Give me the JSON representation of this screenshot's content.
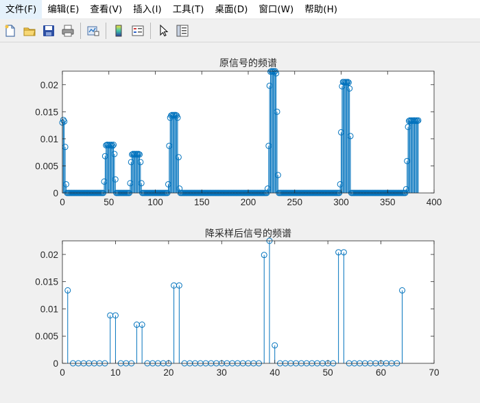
{
  "menu": {
    "items": [
      "文件(F)",
      "编辑(E)",
      "查看(V)",
      "插入(I)",
      "工具(T)",
      "桌面(D)",
      "窗口(W)",
      "帮助(H)"
    ]
  },
  "toolbar": {
    "buttons": [
      "new-figure-icon",
      "open-folder-icon",
      "save-icon",
      "print-icon",
      "link-plot-icon",
      "colorbar-icon",
      "legend-icon",
      "pointer-icon",
      "property-inspector-icon"
    ]
  },
  "colors": {
    "stem": "#0072BD",
    "axis": "#262626",
    "background": "#f0f0f0",
    "plot_bg": "#ffffff"
  },
  "chart_data": [
    {
      "type": "stem",
      "title": "原信号的频谱",
      "xlabel": "",
      "ylabel": "",
      "xlim": [
        0,
        400
      ],
      "ylim": [
        0,
        0.0225
      ],
      "xticks": [
        "0",
        "50",
        "100",
        "150",
        "200",
        "250",
        "300",
        "350",
        "400"
      ],
      "xtick_values": [
        0,
        50,
        100,
        150,
        200,
        250,
        300,
        350,
        400
      ],
      "yticks": [
        "0",
        "0.005",
        "0.01",
        "0.015",
        "0.02"
      ],
      "ytick_values": [
        0,
        0.005,
        0.01,
        0.015,
        0.02
      ],
      "grid": false,
      "n": 384,
      "segments": [
        {
          "x": [
            0,
            1,
            2,
            3,
            4,
            5
          ],
          "y": [
            0.013,
            0.0135,
            0.0132,
            0.0085,
            0.0016,
            0
          ]
        },
        {
          "x": [
            44,
            45,
            46,
            47,
            48,
            49,
            50,
            51,
            52,
            53,
            54,
            55,
            56,
            57,
            58
          ],
          "y": [
            0,
            0.0021,
            0.0068,
            0.0088,
            0.0089,
            0.0089,
            0.0088,
            0.0089,
            0.0088,
            0.0089,
            0.0087,
            0.0089,
            0.0072,
            0.0025,
            0
          ]
        },
        {
          "x": [
            72,
            73,
            74,
            75,
            76,
            77,
            78,
            79,
            80,
            81,
            82,
            83,
            84,
            85,
            86
          ],
          "y": [
            0,
            0.0018,
            0.0057,
            0.0071,
            0.0072,
            0.0071,
            0.0072,
            0.0071,
            0.0072,
            0.0071,
            0.0072,
            0.0071,
            0.0057,
            0.0018,
            0
          ]
        },
        {
          "x": [
            113,
            114,
            115,
            116,
            117,
            118,
            119,
            120,
            121,
            122,
            123,
            124,
            125,
            126,
            127,
            128
          ],
          "y": [
            0,
            0.0016,
            0.0087,
            0.0139,
            0.0143,
            0.0144,
            0.0143,
            0.0144,
            0.0143,
            0.0144,
            0.0143,
            0.0139,
            0.0066,
            0.0008,
            0,
            0
          ]
        },
        {
          "x": [
            220,
            221,
            222,
            223,
            224,
            225,
            226,
            227,
            228,
            229,
            230,
            231,
            232
          ],
          "y": [
            0,
            0.0008,
            0.0087,
            0.0198,
            0.0224,
            0.0225,
            0.0224,
            0.0225,
            0.0224,
            0.0225,
            0.0221,
            0.015,
            0.0033
          ]
        },
        {
          "x": [
            298,
            299,
            300,
            301,
            302,
            303,
            304,
            305,
            306,
            307,
            308,
            309,
            310,
            311
          ],
          "y": [
            0,
            0.0016,
            0.0112,
            0.0197,
            0.0205,
            0.0205,
            0.0204,
            0.0205,
            0.0204,
            0.0205,
            0.0204,
            0.0193,
            0.0105,
            0
          ]
        },
        {
          "x": [
            369,
            370,
            371,
            372,
            373,
            374,
            375,
            376,
            377,
            378,
            379,
            380,
            381,
            382,
            383
          ],
          "y": [
            0,
            0.0007,
            0.0059,
            0.0122,
            0.0133,
            0.0134,
            0.0133,
            0.0134,
            0.0133,
            0.0134,
            0.0134,
            0.0133,
            0.0134,
            0.0133,
            0.0134
          ]
        }
      ]
    },
    {
      "type": "stem",
      "title": "降采样后信号的频谱",
      "xlabel": "",
      "ylabel": "",
      "xlim": [
        0,
        70
      ],
      "ylim": [
        0,
        0.0225
      ],
      "xticks": [
        "0",
        "10",
        "20",
        "30",
        "40",
        "50",
        "60",
        "70"
      ],
      "xtick_values": [
        0,
        10,
        20,
        30,
        40,
        50,
        60,
        70
      ],
      "yticks": [
        "0",
        "0.005",
        "0.01",
        "0.015",
        "0.02"
      ],
      "ytick_values": [
        0,
        0.005,
        0.01,
        0.015,
        0.02
      ],
      "grid": false,
      "x": [
        1,
        2,
        3,
        4,
        5,
        6,
        7,
        8,
        9,
        10,
        11,
        12,
        13,
        14,
        15,
        16,
        17,
        18,
        19,
        20,
        21,
        22,
        23,
        24,
        25,
        26,
        27,
        28,
        29,
        30,
        31,
        32,
        33,
        34,
        35,
        36,
        37,
        38,
        39,
        40,
        41,
        42,
        43,
        44,
        45,
        46,
        47,
        48,
        49,
        50,
        51,
        52,
        53,
        54,
        55,
        56,
        57,
        58,
        59,
        60,
        61,
        62,
        63,
        64
      ],
      "y": [
        0.0134,
        0,
        0,
        0,
        0,
        0,
        0,
        0,
        0.0088,
        0.0088,
        0,
        0,
        0,
        0.0071,
        0.0071,
        0,
        0,
        0,
        0,
        0,
        0.0143,
        0.0143,
        0,
        0,
        0,
        0,
        0,
        0,
        0,
        0,
        0,
        0,
        0,
        0,
        0,
        0,
        0,
        0.0199,
        0.0225,
        0.0033,
        0,
        0,
        0,
        0,
        0,
        0,
        0,
        0,
        0,
        0,
        0,
        0.0204,
        0.0204,
        0,
        0,
        0,
        0,
        0,
        0,
        0,
        0,
        0,
        0,
        0.0134
      ]
    }
  ]
}
